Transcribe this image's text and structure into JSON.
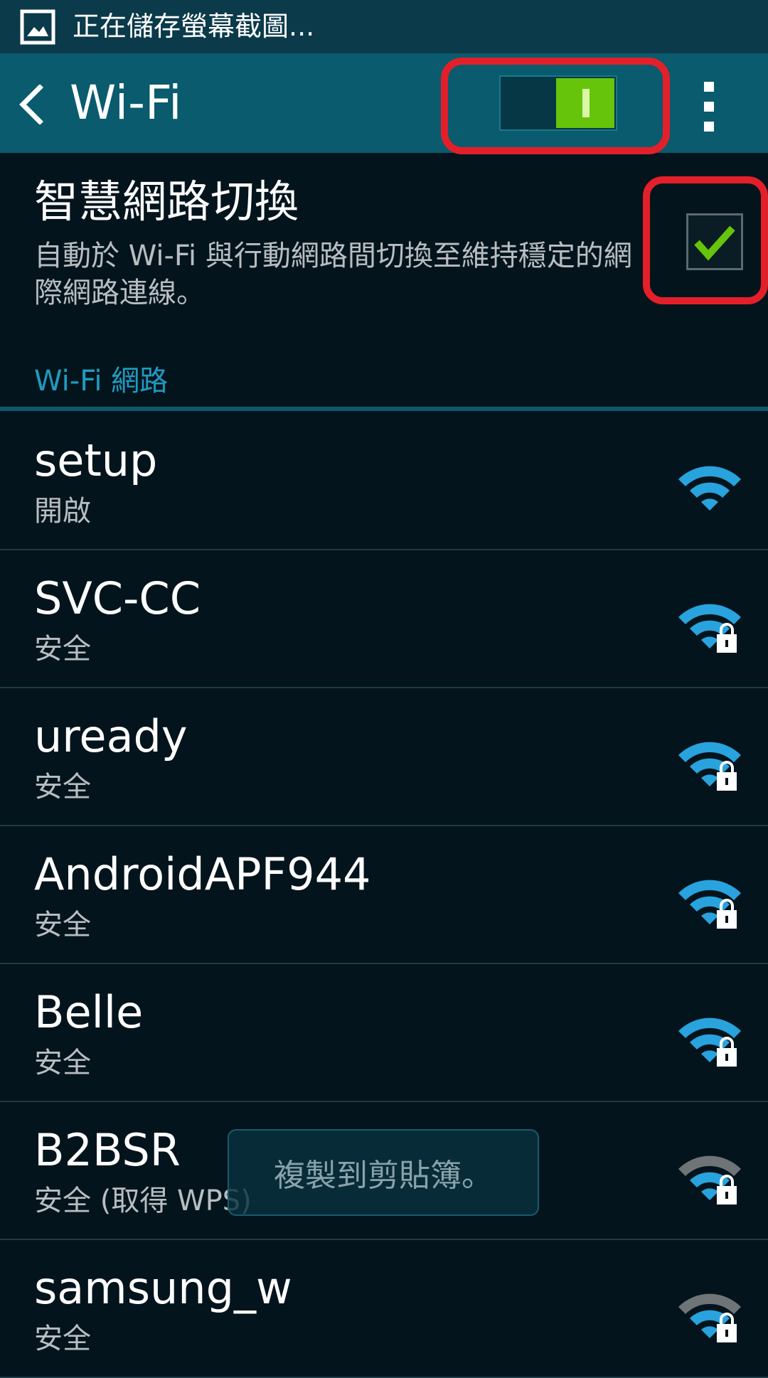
{
  "status_bar": {
    "icon": "screenshot-image-icon",
    "text": "正在儲存螢幕截圖..."
  },
  "action_bar": {
    "back_icon": "chevron-left-icon",
    "title": "Wi-Fi",
    "wifi_toggle_state": "on",
    "overflow_icon": "vertical-dots-icon"
  },
  "smart_switch": {
    "title": "智慧網路切換",
    "description": "自動於 Wi-Fi 與行動網路間切換至維持穩定的網際網路連線。",
    "checked": true
  },
  "section": {
    "header": "Wi-Fi 網路"
  },
  "networks": [
    {
      "ssid": "setup",
      "security": "開啟",
      "locked": false,
      "signal_color": "#29a3dd"
    },
    {
      "ssid": "SVC-CC",
      "security": "安全",
      "locked": true,
      "signal_color": "#29a3dd"
    },
    {
      "ssid": "uready",
      "security": "安全",
      "locked": true,
      "signal_color": "#29a3dd"
    },
    {
      "ssid": "AndroidAPF944",
      "security": "安全",
      "locked": true,
      "signal_color": "#29a3dd"
    },
    {
      "ssid": "Belle",
      "security": "安全",
      "locked": true,
      "signal_color": "#29a3dd"
    },
    {
      "ssid": "B2BSR",
      "security": "安全 (取得 WPS)",
      "locked": true,
      "signal_color": "#29a3dd"
    },
    {
      "ssid": "samsung_w",
      "security": "安全",
      "locked": true,
      "signal_color": "#29a3dd"
    }
  ],
  "toast": {
    "text": "複製到剪貼簿。"
  },
  "colors": {
    "highlight": "#e3202a",
    "toggle_on": "#66c40b",
    "accent": "#1f9bc0"
  }
}
